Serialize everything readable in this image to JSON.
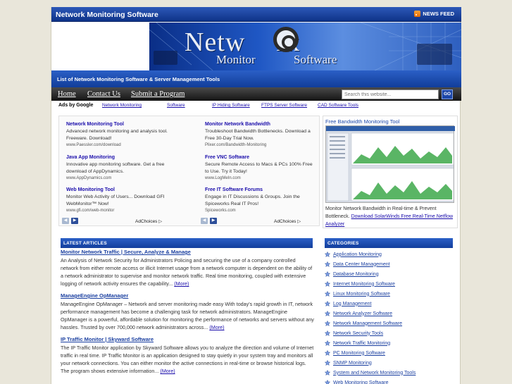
{
  "header": {
    "site_title": "Network Monitoring Software",
    "rss_label": "NEWS FEED",
    "logo": {
      "line1": "Netw",
      "line1b": "rk",
      "line2": "Monitor",
      "line3": "Software"
    },
    "tagline": "List of Network Monitoring Software & Server Management Tools"
  },
  "nav": {
    "items": [
      "Home",
      "Contact Us",
      "Submit a Program"
    ],
    "search_placeholder": "Search this website...",
    "go_label": "GO"
  },
  "ads_row": {
    "label": "Ads by Google",
    "links": [
      "Network Monitoring",
      "Software",
      "IP Hiding Software",
      "FTPS Server Software",
      "CAD Software Tools"
    ]
  },
  "ads": [
    {
      "title": "Network Monitoring Tool",
      "desc": "Advanced network monitoring and analysis tool. Freeware. Download!",
      "url": "www.Paessler.com/download"
    },
    {
      "title": "Monitor Network Bandwidth",
      "desc": "Troubleshoot Bandwidth Bottlenecks. Download a Free 30-Day Trial Now.",
      "url": "Plixer.com/Bandwidth-Monitoring"
    },
    {
      "title": "Java App Monitoring",
      "desc": "Innovative app monitoring software. Get a free download of AppDynamics.",
      "url": "www.AppDynamics.com"
    },
    {
      "title": "Free VNC Software",
      "desc": "Secure Remote Access to Macs & PCs 100% Free to Use. Try it Today!",
      "url": "www.LogMeIn.com"
    },
    {
      "title": "Web Monitoring Tool",
      "desc": "Monitor Web Activity of Users... Download GFI WebMonitor™ Now!",
      "url": "www.gfi.com/web-monitor"
    },
    {
      "title": "Free IT Software Forums",
      "desc": "Engage in IT Discussions & Groups. Join the Spiceworks Real IT Pros!",
      "url": "Spiceworks.com"
    }
  ],
  "adchoices_label": "AdChoices",
  "widget": {
    "title": "Free Bandwidth Monitoring Tool",
    "text": "Monitor Network Bandwidth in Real-time & Prevent Bottleneck.",
    "link": "Download SolarWinds Free Real-Time Netflow Analyzer"
  },
  "latest": {
    "heading": "LATEST ARTICLES",
    "more_label": "(More)",
    "articles": [
      {
        "title": "Monitor Network Traffic | Secure, Analyze & Manage",
        "body": "An Analysis of Network Security for Administrators Policing and securing the use of a company controlled network from either remote access or illicit Internet usage from a network computer is dependent on the ability of a network administrator to supervise and monitor network traffic. Real time monitoring, coupled with extensive logging of network activity ensures the capability..."
      },
      {
        "title": "ManageEngine OpManager",
        "body": "ManageEngine OpManager – Network and server monitoring made easy With today's rapid growth in IT, network performance management has become a challenging task for network administrators. ManageEngine OpManager is a powerful, affordable solution for monitoring the performance of networks and servers without any hassles. Trusted by over 700,000 network administrators across..."
      },
      {
        "title": "IP Traffic Monitor | Skyward Software",
        "body": "The IP Traffic Monitor application by Skyward Software allows you to analyze the direction and volume of Internet traffic in real time. IP Traffic Monitor is an application designed to stay quietly in your system tray and monitors all your network connections. You can either monitor the active connections in real-time or browse historical logs. The program shows extensive information..."
      }
    ]
  },
  "categories": {
    "heading": "CATEGORIES",
    "items": [
      "Application Monitoring",
      "Data Center Management",
      "Database Monitoring",
      "Internet Monitoring Software",
      "Linux Monitoring Software",
      "Log Management",
      "Network Analyzer Software",
      "Network Management Software",
      "Network Security Tools",
      "Network Traffic Monitoring",
      "PC Monitoring Software",
      "SNMP Monitoring",
      "System and Network Monitoring Tools",
      "Web Monitoring Software"
    ]
  },
  "colors": {
    "accent": "#1d47a8",
    "link": "#1a0dab",
    "nav_bg": "#1e1e1e",
    "page_bg": "#e9e6da"
  }
}
